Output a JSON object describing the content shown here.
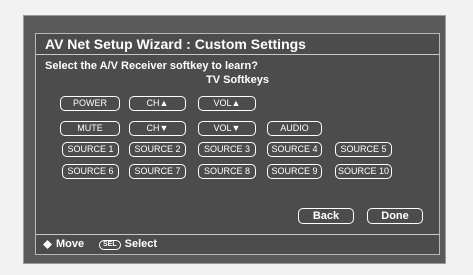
{
  "title": "AV Net Setup Wizard : Custom Settings",
  "instruction": "Select the A/V Receiver softkey to learn?",
  "subtitle": "TV Softkeys",
  "keys": {
    "power": "POWER",
    "ch_up": "CH▲",
    "vol_up": "VOL▲",
    "mute": "MUTE",
    "ch_down": "CH▼",
    "vol_down": "VOL▼",
    "audio": "AUDIO",
    "sources_row1": [
      "SOURCE 1",
      "SOURCE 2",
      "SOURCE 3",
      "SOURCE 4",
      "SOURCE 5"
    ],
    "sources_row2": [
      "SOURCE 6",
      "SOURCE 7",
      "SOURCE 8",
      "SOURCE 9",
      "SOURCE 10"
    ]
  },
  "actions": {
    "back": "Back",
    "done": "Done"
  },
  "footer": {
    "move_label": "Move",
    "select_badge": "SEL",
    "select_label": "Select",
    "move_icon": "four-way-arrow-icon"
  },
  "colors": {
    "panel": "#4c4c4c",
    "frame": "#5a5a5a",
    "text": "#ffffff"
  }
}
